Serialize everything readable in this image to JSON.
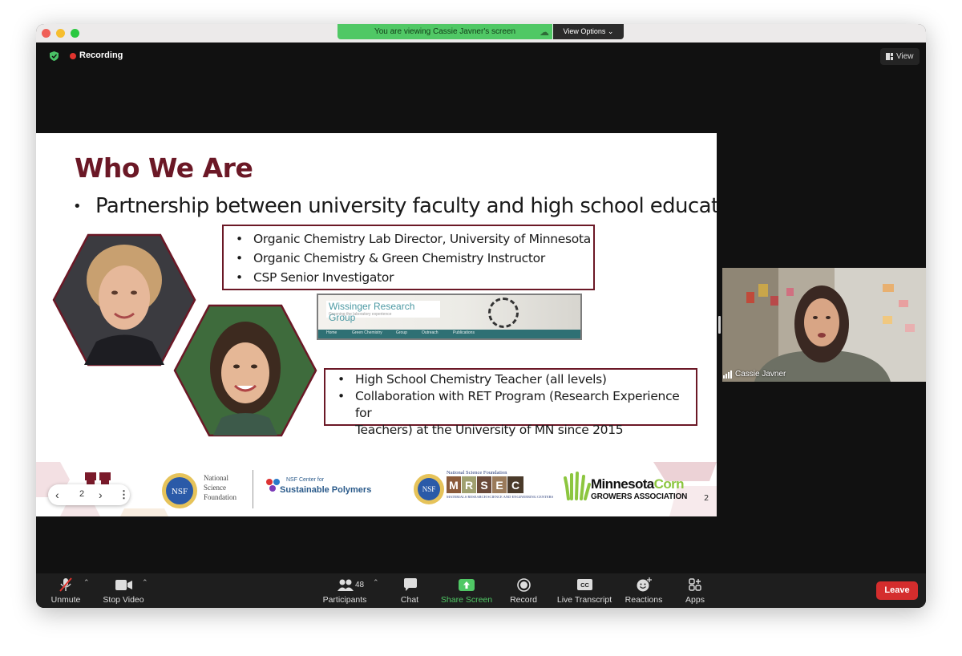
{
  "banner": {
    "viewing_text": "You are viewing Cassie Javner's screen",
    "view_options": "View Options"
  },
  "meeting": {
    "recording_label": "Recording",
    "view_label": "View"
  },
  "slide": {
    "title": "Who We Are",
    "main_bullet": "Partnership between university faculty and high school educators",
    "box1_items": [
      "Organic Chemistry Lab Director, University of Minnesota",
      "Organic Chemistry & Green Chemistry Instructor",
      "CSP Senior Investigator"
    ],
    "box2_items": [
      "High School Chemistry Teacher (all levels)",
      "Collaboration with RET Program (Research Experience for",
      "Teachers) at the University of MN since 2015"
    ],
    "website": {
      "title": "Wissinger Research Group",
      "subtitle": "Greening the laboratory experience",
      "nav": [
        "Home",
        "Green Chemistry",
        "Group",
        "Outreach",
        "Publications"
      ]
    },
    "page_number": "2",
    "logos": {
      "nsf_badge": "NSF",
      "nsf_lines": [
        "National",
        "Science",
        "Foundation"
      ],
      "csp_small": "NSF Center for",
      "csp_big": "Sustainable Polymers",
      "mrsec_top": "National Science Foundation",
      "mrsec_letters": [
        "M",
        "R",
        "S",
        "E",
        "C"
      ],
      "mrsec_bottom": "MATERIALS RESEARCH SCIENCE AND ENGINEERING CENTERS",
      "corn_a": "Minnesota",
      "corn_b": "Corn",
      "corn_c": "GROWERS ASSOCIATION"
    }
  },
  "slide_nav": {
    "current_page": "2"
  },
  "speaker": {
    "name": "Cassie Javner"
  },
  "toolbar": {
    "unmute": "Unmute",
    "stop_video": "Stop Video",
    "participants": "Participants",
    "participants_count": "48",
    "chat": "Chat",
    "share_screen": "Share Screen",
    "record": "Record",
    "live_transcript": "Live Transcript",
    "reactions": "Reactions",
    "apps": "Apps",
    "leave": "Leave"
  }
}
